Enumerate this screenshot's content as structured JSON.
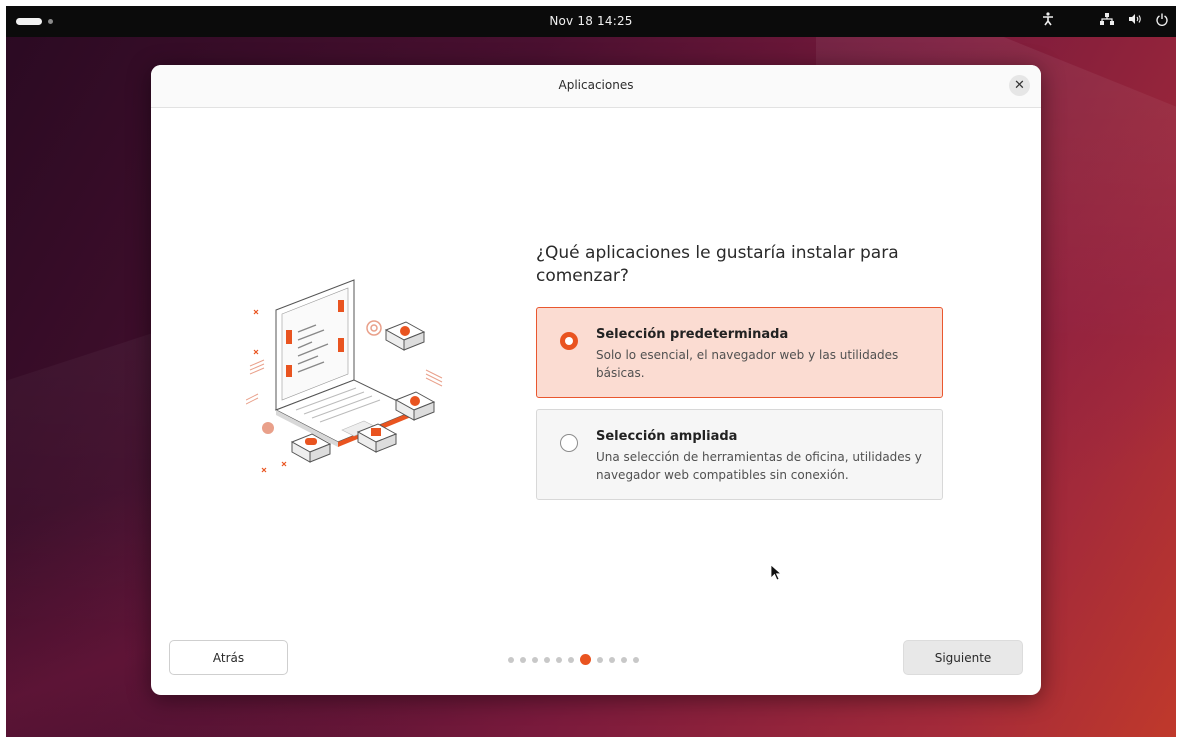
{
  "topbar": {
    "clock": "Nov 18  14:25",
    "icons": [
      "activities-indicator",
      "accessibility-icon",
      "network-icon",
      "volume-icon",
      "power-icon"
    ]
  },
  "dialog": {
    "title": "Aplicaciones",
    "close_icon": "close-icon",
    "question": "¿Qué aplicaciones le gustaría instalar para comenzar?",
    "options": [
      {
        "label": "Selección predeterminada",
        "description": "Solo lo esencial, el navegador web y las utilidades básicas.",
        "selected": true
      },
      {
        "label": "Selección ampliada",
        "description": "Una selección de herramientas de oficina, utilidades y navegador web compatibles sin conexión.",
        "selected": false
      }
    ],
    "back_label": "Atrás",
    "next_label": "Siguiente",
    "pager": {
      "total": 11,
      "current": 7
    }
  },
  "colors": {
    "accent": "#E95420",
    "selected_bg": "#FBDCD2",
    "topbar_bg": "#0B0B0B"
  }
}
